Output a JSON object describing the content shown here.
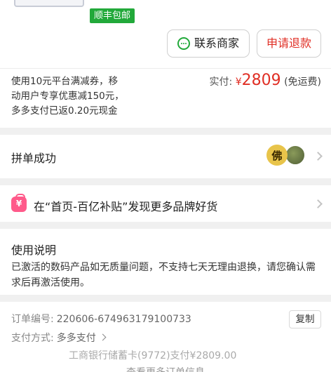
{
  "product": {
    "shipping_badge": "顺丰包邮"
  },
  "actions": {
    "contact_label": "联系商家",
    "refund_label": "申请退款"
  },
  "payment": {
    "promo_lines": [
      "使用10元平台满减券，移",
      "动用户专享优惠减150元，",
      "多多支付已返0.20元现金"
    ],
    "paid_label": "实付:",
    "currency": "¥",
    "amount": "2809",
    "shipping_note": "(免运费)"
  },
  "group": {
    "title": "拼单成功",
    "avatar_text": "佛"
  },
  "subsidy": {
    "text": "在“首页-百亿补贴”发现更多品牌好货"
  },
  "usage": {
    "title": "使用说明",
    "body": "已激活的数码产品如无质量问题，不支持七天无理由退换，请您确认需求后再激活使用。"
  },
  "order": {
    "number_label": "订单编号:",
    "number": "220606-674963179100733",
    "copy_label": "复制",
    "pay_label": "支付方式:",
    "pay_value": "多多支付",
    "bank_detail": "工商银行储蓄卡(9772)支付¥2809.00",
    "more_label": "查看更多订单信息"
  },
  "colors": {
    "accent_red": "#e02e24",
    "badge_green": "#22a93a"
  }
}
